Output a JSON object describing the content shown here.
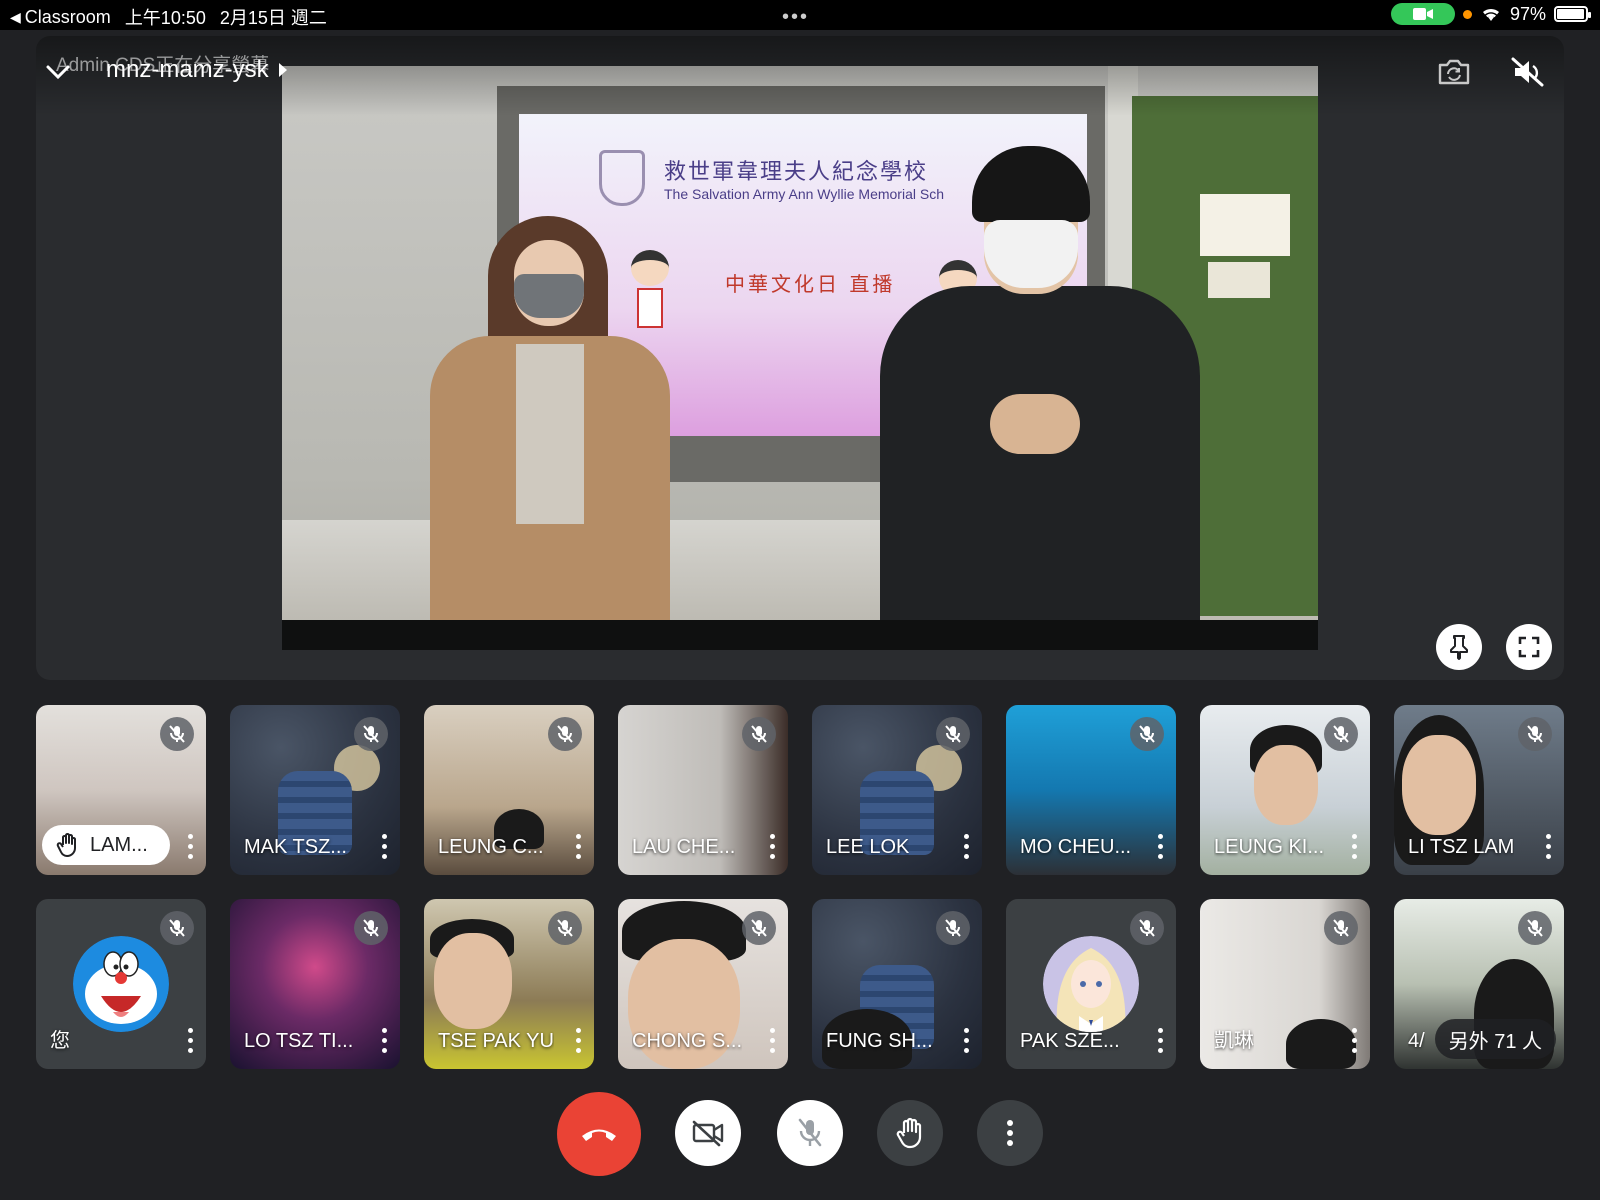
{
  "status_bar": {
    "back_app": "Classroom",
    "time": "上午10:50",
    "date": "2月15日 週二",
    "battery": "97%",
    "battery_level": 0.97
  },
  "meeting": {
    "presenting_notice": "Admin CDS正在分享螢幕",
    "code": "mnz-mamz-ysk"
  },
  "shared_screen": {
    "school_name_cn": "救世軍韋理夫人紀念學校",
    "school_name_en": "The Salvation Army Ann Wyllie Memorial Sch",
    "event_title": "中華文化日 直播"
  },
  "participants_row1": [
    {
      "name": "LAM...",
      "hand_raised": true
    },
    {
      "name": "MAK TSZ..."
    },
    {
      "name": "LEUNG C..."
    },
    {
      "name": "LAU CHE..."
    },
    {
      "name": "LEE LOK"
    },
    {
      "name": "MO CHEU..."
    },
    {
      "name": "LEUNG KI..."
    },
    {
      "name": "LI TSZ LAM"
    }
  ],
  "participants_row2": [
    {
      "name": "您"
    },
    {
      "name": "LO TSZ TI..."
    },
    {
      "name": "TSE PAK YU"
    },
    {
      "name": "CHONG S..."
    },
    {
      "name": "FUNG SH..."
    },
    {
      "name": "PAK SZE..."
    },
    {
      "name": "凱琳"
    },
    {
      "name": "4/"
    }
  ],
  "others_count_label": "另外 71 人",
  "colors": {
    "end_call": "#ea4335",
    "background": "#202124",
    "tile": "#3c4043"
  }
}
